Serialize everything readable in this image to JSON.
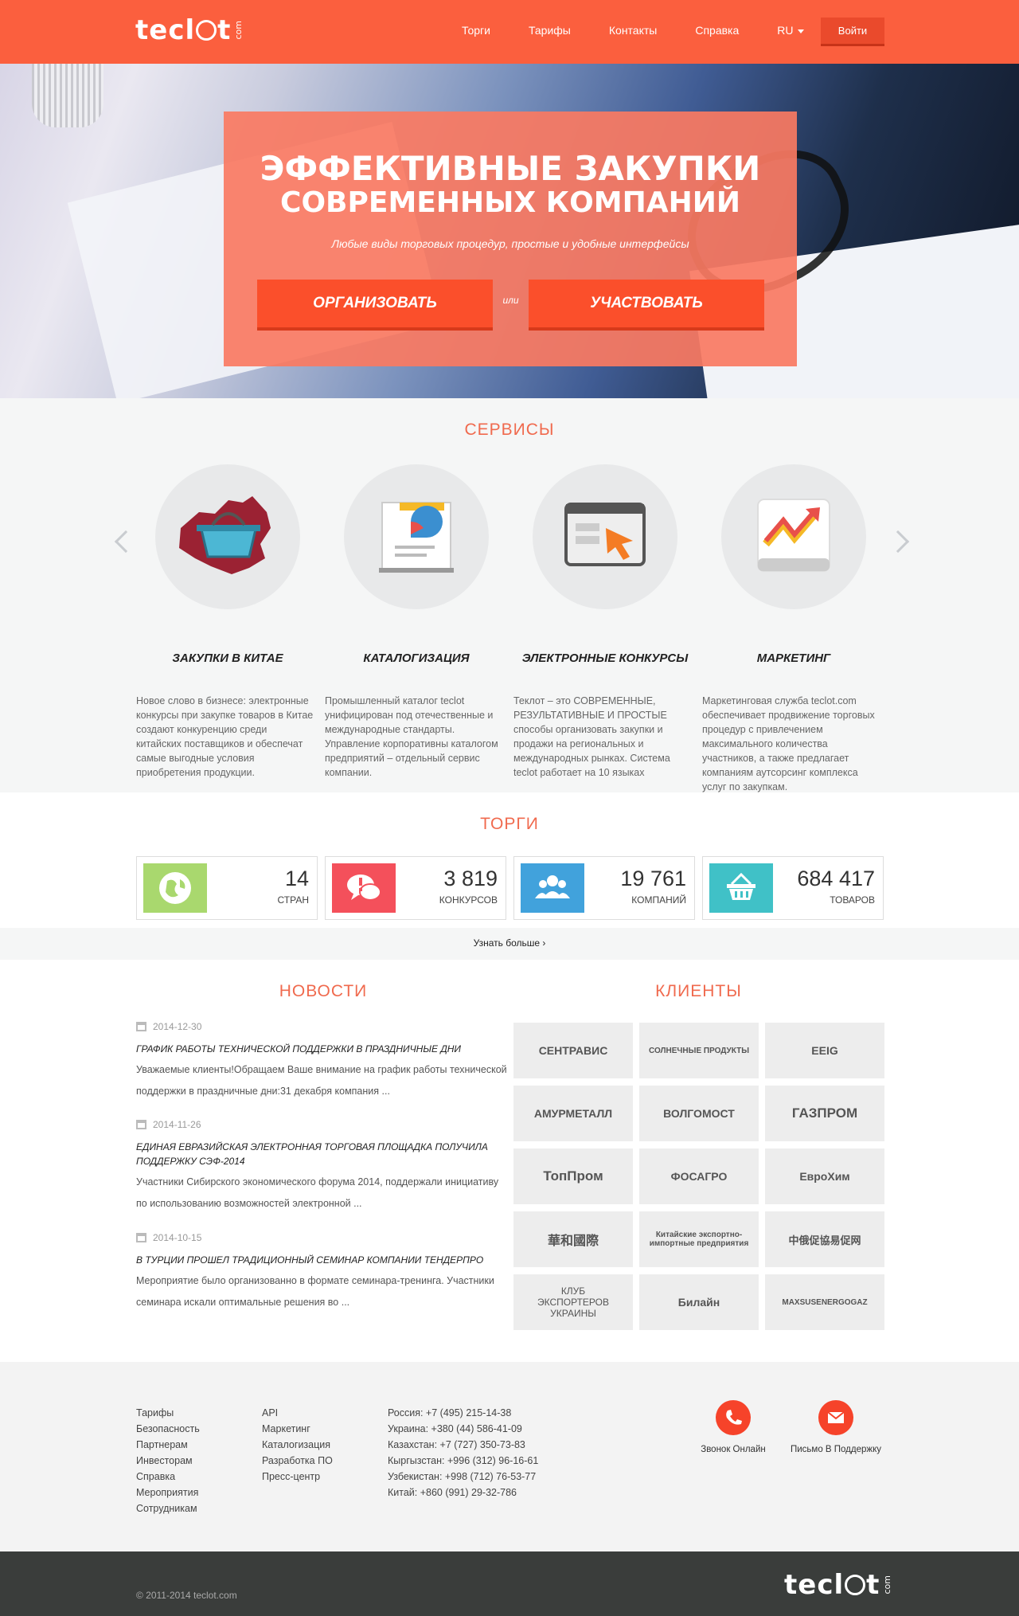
{
  "header": {
    "logo_text_1": "tecl",
    "logo_text_2": "t",
    "logo_suffix": "com",
    "nav": [
      "Торги",
      "Тарифы",
      "Контакты",
      "Справка"
    ],
    "lang": "RU",
    "login": "Войти"
  },
  "hero": {
    "title_1": "ЭФФЕКТИВНЫЕ ЗАКУПКИ",
    "title_2": "СОВРЕМЕННЫХ КОМПАНИЙ",
    "subtitle": "Любые виды торговых процедур, простые и удобные интерфейсы",
    "btn_organize": "ОРГАНИЗОВАТЬ",
    "or": "или",
    "btn_participate": "УЧАСТВОВАТЬ"
  },
  "services": {
    "title": "СЕРВИСЫ",
    "items": [
      {
        "title": "ЗАКУПКИ В КИТАЕ",
        "text": "Новое слово в бизнесе: электронные конкурсы при закупке товаров в Китае создают конкуренцию среди китайских поставщиков и обеспечат самые выгодные условия приобретения продукции."
      },
      {
        "title": "КАТАЛОГИЗАЦИЯ",
        "text": "Промышленный каталог teclot унифицирован под отечественные и международные стандарты. Управление корпоративны каталогом предприятий – отдельный сервис компании."
      },
      {
        "title": "ЭЛЕКТРОННЫЕ КОНКУРСЫ",
        "text": "Теклот – это СОВРЕМЕННЫЕ, РЕЗУЛЬТАТИВНЫЕ И ПРОСТЫЕ способы организовать закупки и продажи на региональных и международных рынках. Система teclot работает на 10 языках"
      },
      {
        "title": "МАРКЕТИНГ",
        "text": "Маркетинговая служба teclot.com обеспечивает продвижение торговых процедур с привлечением максимального количества участников, а также предлагает компаниям аутсорсинг комплекса услуг по закупкам."
      }
    ]
  },
  "torgi": {
    "title": "ТОРГИ",
    "stats": [
      {
        "value": "14",
        "label": "СТРАН",
        "color": "#a9d86e"
      },
      {
        "value": "3 819",
        "label": "КОНКУРСОВ",
        "color": "#f4505b"
      },
      {
        "value": "19 761",
        "label": "КОМПАНИЙ",
        "color": "#41a2dc"
      },
      {
        "value": "684 417",
        "label": "ТОВАРОВ",
        "color": "#40c1c7"
      }
    ],
    "more": "Узнать больше ›"
  },
  "news": {
    "title": "НОВОСТИ",
    "items": [
      {
        "date": "2014-12-30",
        "head": "График работы технической поддержки в праздничные дни",
        "text": "Уважаемые клиенты!Обращаем Ваше внимание на график работы технической поддержки в праздничные дни:31 декабря компания ..."
      },
      {
        "date": "2014-11-26",
        "head": "Единая Евразийская электронная торговая площадка получила поддержку СЭФ-2014",
        "text": "Участники Сибирского экономического форума 2014, поддержали инициативу по использованию возможностей электронной ..."
      },
      {
        "date": "2014-10-15",
        "head": "В Турции прошел традиционный семинар компании Тендерпро",
        "text": "Мероприятие было организованно в формате семинара-тренинга. Участники семинара искали оптимальные решения во ..."
      }
    ]
  },
  "clients": {
    "title": "КЛИЕНТЫ",
    "logos": [
      "СЕНТРАВИС",
      "СОЛНЕЧНЫЕ ПРОДУКТЫ",
      "EEIG",
      "АМУРМЕТАЛЛ",
      "ВОЛГОМОСТ",
      "ГАЗПРОМ",
      "ТопПром",
      "ФОСАГРО",
      "ЕвроХим",
      "華和國際",
      "Китайские экспортно-импортные предприятия",
      "中俄促協易促网",
      "КЛУБ ЭКСПОРТЕРОВ УКРАИНЫ",
      "Билайн",
      "MAXSUSENERGOGAZ"
    ]
  },
  "footer": {
    "col1": [
      "Тарифы",
      "Безопасность",
      "Партнерам",
      "Инвесторам",
      "Справка",
      "Мероприятия",
      "Сотрудникам"
    ],
    "col2": [
      "API",
      "Маркетинг",
      "Каталогизация",
      "Разработка ПО",
      "Пресс-центр"
    ],
    "col3": [
      "Россия: +7 (495) 215-14-38",
      "Украина: +380 (44) 586-41-09",
      "Казахстан: +7 (727) 350-73-83",
      "Кыргызстан: +996 (312) 96-16-61",
      "Узбекистан: +998 (712) 76-53-77",
      "Китай: +860 (991) 29-32-786"
    ],
    "call_online": "Звонок Онлайн",
    "mail_support": "Письмо В Поддержку",
    "copyright": "© 2011-2014 teclot.com"
  }
}
